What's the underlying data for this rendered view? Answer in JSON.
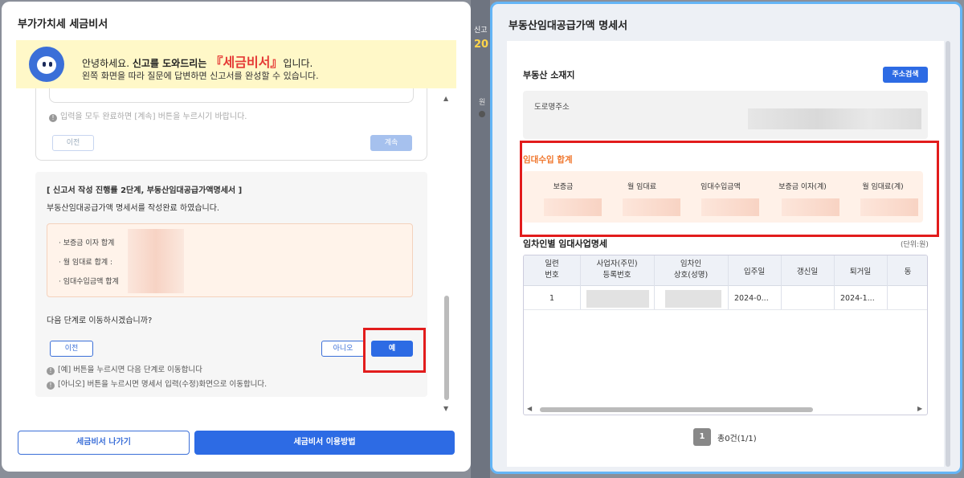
{
  "backdrop": {
    "text1": "신고",
    "text2": "20",
    "text3": "원"
  },
  "left_panel": {
    "title": "부가가치세 세금비서",
    "greeting": {
      "line1_prefix": "안녕하세요. ",
      "line1_bold": "신고를 도와드리는 ",
      "line1_brand": "『세금비서』",
      "line1_suffix": "입니다.",
      "line2": "왼쪽 화면을 따라 질문에 답변하면 신고서를 완성할 수 있습니다."
    },
    "prev_step": {
      "hint": "입력을 모두 완료하면 [계속] 버튼을 누르시기 바랍니다.",
      "prev_button": "이전",
      "continue_button": "계속"
    },
    "current_step": {
      "stage_title": "[ 신고서 작성 진행률 2단계, 부동산임대공급가액명세서 ]",
      "done_text": "부동산임대공급가액 명세서를 작성완료 하였습니다.",
      "summary_rows": [
        "· 보증금 이자 합계",
        "· 월 임대료 합계 :",
        "· 임대수입금액 합계"
      ],
      "question": "다음 단계로 이동하시겠습니까?",
      "prev_button": "이전",
      "no_button": "아니오",
      "yes_button": "예",
      "note1": "[예] 버튼을 누르시면 다음 단계로 이동합니다",
      "note2": "[아니오] 버튼을 누르시면 명세서 입력(수정)화면으로 이동합니다."
    },
    "exit_button": "세금비서 나가기",
    "howto_button": "세금비서 이용방법"
  },
  "right_panel": {
    "title": "부동산임대공급가액 명세서",
    "location_label": "부동산 소재지",
    "address_search_button": "주소검색",
    "road_address_label": "도로명주소",
    "rent_income_title": "임대수입 합계",
    "rent_income_headers": [
      "보증금",
      "월 임대료",
      "임대수입금액",
      "보증금 이자(계)",
      "월 임대료(계)"
    ],
    "lessee_title": "임차인별 임대사업명세",
    "unit": "(단위:원)",
    "lessee_headers": [
      "일련\n번호",
      "사업자(주민)\n등록번호",
      "임차인\n상호(성명)",
      "입주일",
      "갱신일",
      "퇴거일",
      "동"
    ],
    "lessee_rows": [
      {
        "no": "1",
        "move_in": "2024-0...",
        "move_out": "2024-1..."
      }
    ],
    "pager": {
      "current": "1",
      "total": "총0건(1/1)"
    }
  },
  "colors": {
    "primary": "#2d6be4",
    "highlight": "#e21c1c",
    "brand_text": "#e53935",
    "rent_title": "#f0762c",
    "panel_border": "#64b5f6"
  }
}
